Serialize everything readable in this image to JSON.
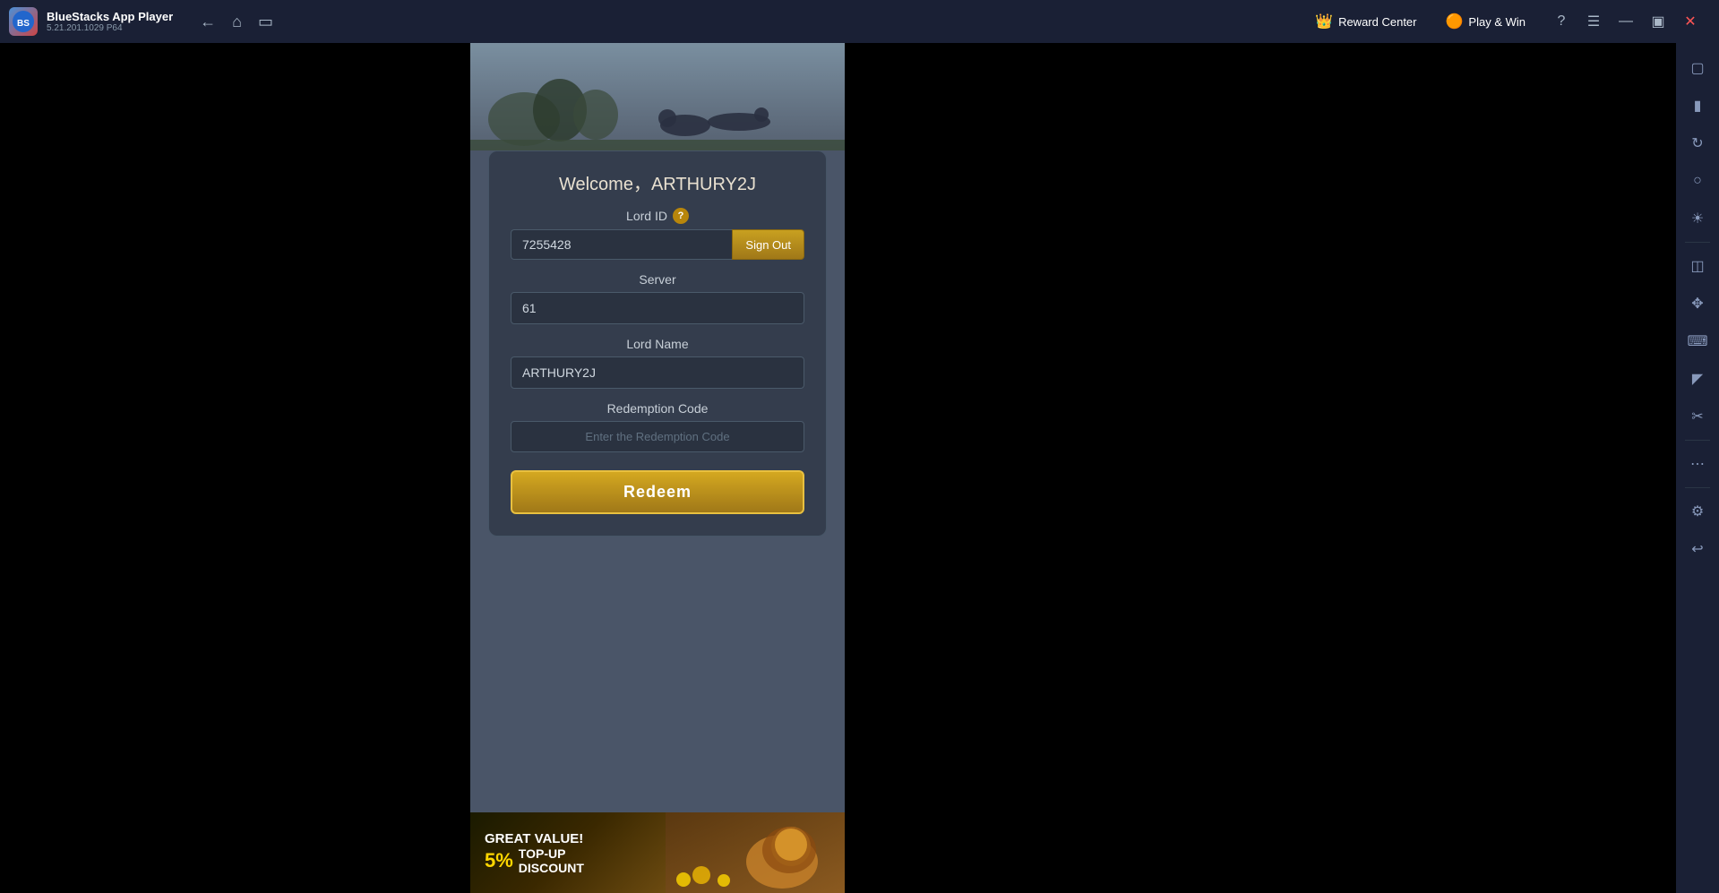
{
  "titlebar": {
    "app_name": "BlueStacks App Player",
    "app_version": "5.21.201.1029  P64",
    "logo_text": "BS",
    "nav": {
      "back_label": "←",
      "home_label": "⌂",
      "multi_label": "⧉"
    },
    "reward_center_label": "Reward Center",
    "play_win_label": "Play & Win",
    "help_label": "?",
    "menu_label": "≡",
    "minimize_label": "—",
    "maximize_label": "⬜",
    "close_label": "✕"
  },
  "game": {
    "welcome_title": "Welcome，ARTHURY2J",
    "lord_id_label": "Lord ID",
    "lord_id_value": "7255428",
    "sign_out_label": "Sign Out",
    "server_label": "Server",
    "server_value": "61",
    "lord_name_label": "Lord Name",
    "lord_name_value": "ARTHURY2J",
    "redemption_code_label": "Redemption Code",
    "redemption_code_placeholder": "Enter the Redemption Code",
    "redeem_button_label": "Redeem"
  },
  "banner": {
    "great_value_label": "GREAT",
    "value_suffix": "VALUE!",
    "percent": "5%",
    "top_up_label": "TOP-UP",
    "discount_label": "DISCOUNT"
  },
  "sidebar": {
    "icons": [
      {
        "name": "settings-icon",
        "symbol": "⚙"
      },
      {
        "name": "screen-icon",
        "symbol": "🖥"
      },
      {
        "name": "rotate-icon",
        "symbol": "↻"
      },
      {
        "name": "location-icon",
        "symbol": "◎"
      },
      {
        "name": "camera-icon",
        "symbol": "📷"
      },
      {
        "name": "apk-icon",
        "symbol": "⬇"
      },
      {
        "name": "resize-icon",
        "symbol": "⤢"
      },
      {
        "name": "keyboard-icon",
        "symbol": "⌨"
      },
      {
        "name": "game-icon",
        "symbol": "🎮"
      },
      {
        "name": "screenshot-icon",
        "symbol": "✂"
      },
      {
        "name": "more-icon",
        "symbol": "•••"
      },
      {
        "name": "main-settings-icon",
        "symbol": "⚙"
      },
      {
        "name": "back2-icon",
        "symbol": "↩"
      }
    ]
  }
}
